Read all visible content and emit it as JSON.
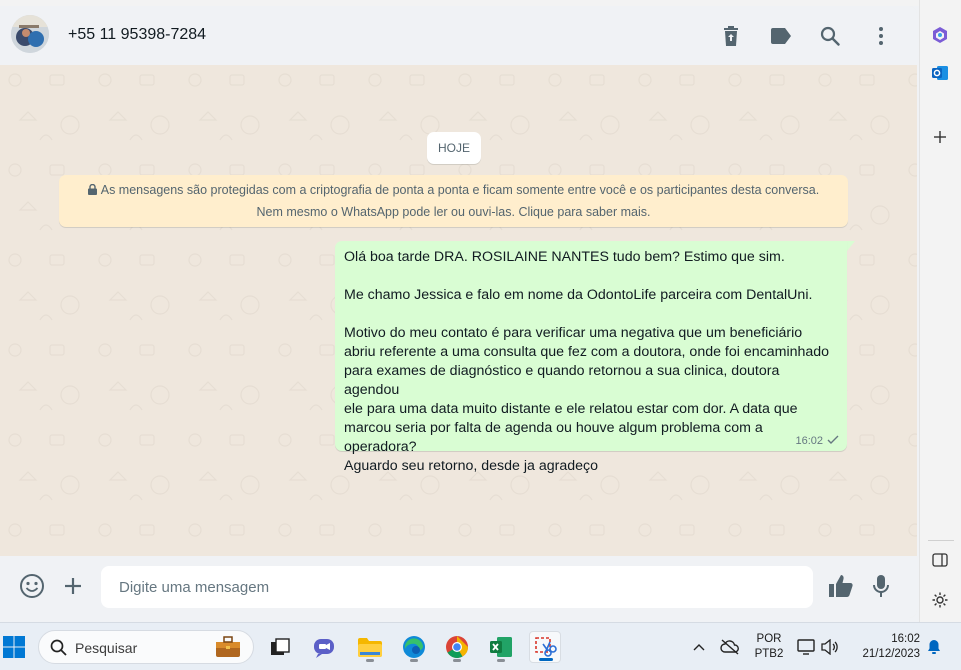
{
  "header": {
    "contact": "+55 11 95398-7284",
    "icons": [
      "delete-icon",
      "label-icon",
      "search-icon",
      "menu-icon"
    ]
  },
  "chat": {
    "date_chip": "HOJE",
    "encryption_notice": "As mensagens são protegidas com a criptografia de ponta a ponta e ficam somente entre você e os participantes desta conversa. Nem mesmo o WhatsApp pode ler ou ouvi-las. Clique para saber mais.",
    "message": {
      "line1": "Olá boa tarde DRA. ROSILAINE NANTES tudo bem? Estimo que sim.",
      "line2": "Me chamo Jessica e falo em nome da OdontoLife parceira com DentalUni.",
      "para3_l1": "Motivo do meu contato é para verificar uma negativa que um beneficiário",
      "para3_l2": "abriu referente a uma consulta que fez com a doutora, onde foi encaminhado",
      "para3_l3": "para exames de diagnóstico e quando retornou a sua clinica, doutora agendou",
      "para3_l4": "ele para uma data muito distante e ele relatou estar com dor. A data que",
      "para3_l5": "marcou seria por falta de agenda ou houve algum problema com a operadora?",
      "para3_l6": "Aguardo seu retorno, desde ja agradeço",
      "time": "16:02",
      "status": "sent"
    }
  },
  "composer": {
    "placeholder": "Digite uma mensagem",
    "icons": [
      "emoji-icon",
      "attach-plus-icon",
      "thumbs-up-icon",
      "microphone-icon"
    ]
  },
  "taskbar": {
    "search_label": "Pesquisar",
    "lang_top": "POR",
    "lang_bottom": "PTB2",
    "time": "16:02",
    "date": "21/12/2023"
  },
  "colors": {
    "accent_green": "#d9fdd3",
    "notice_yellow": "#ffeecd",
    "chat_bg": "#efe7dd",
    "header_bg": "#f0f2f5"
  }
}
